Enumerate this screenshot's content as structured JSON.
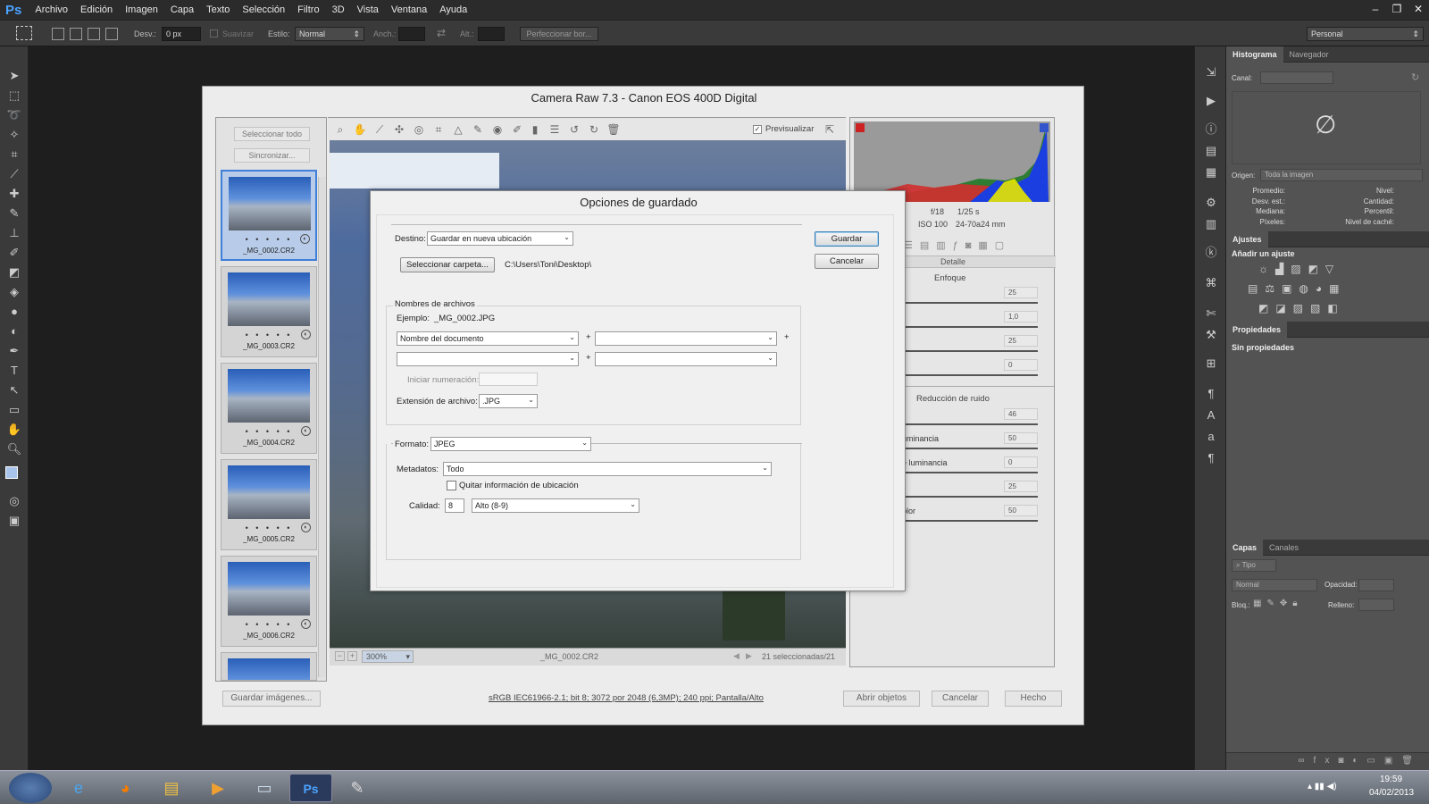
{
  "app": {
    "logo": "Ps"
  },
  "menu": [
    "Archivo",
    "Edición",
    "Imagen",
    "Capa",
    "Texto",
    "Selección",
    "Filtro",
    "3D",
    "Vista",
    "Ventana",
    "Ayuda"
  ],
  "window_buttons": [
    "–",
    "❐",
    "✕"
  ],
  "options_bar": {
    "desv_label": "Desv.:",
    "desv_value": "0 px",
    "suavizar_label": "Suavizar",
    "estilo_label": "Estilo:",
    "estilo_value": "Normal",
    "anch_label": "Anch.:",
    "alt_label": "Alt.:",
    "refine_button": "Perfeccionar bor...",
    "workspace": "Personal"
  },
  "histogram_panel": {
    "tabs": [
      "Histograma",
      "Navegador"
    ],
    "canal_label": "Canal:",
    "origen_label": "Origen:",
    "origen_value": "Toda la imagen",
    "stats_left": [
      "Promedio:",
      "Desv. est.:",
      "Mediana:",
      "Píxeles:"
    ],
    "stats_right": [
      "Nivel:",
      "Cantidad:",
      "Percentil:",
      "Nivel de caché:"
    ]
  },
  "adjustments_panel": {
    "tab": "Ajustes",
    "subtitle": "Añadir un ajuste"
  },
  "properties_panel": {
    "tab": "Propiedades",
    "empty": "Sin propiedades"
  },
  "layers_panel": {
    "tabs": [
      "Capas",
      "Canales"
    ],
    "filter": "Tipo",
    "blend": "Normal",
    "opacity_label": "Opacidad:",
    "lock_label": "Bloq.:",
    "fill_label": "Relleno:"
  },
  "camera_raw": {
    "title": "Camera Raw 7.3 -  Canon EOS 400D Digital",
    "select_all": "Seleccionar todo",
    "sync": "Sincronizar...",
    "thumbnails": [
      {
        "caption": "_MG_0002.CR2",
        "dots": "• • • • •"
      },
      {
        "caption": "_MG_0003.CR2",
        "dots": "• • • • •"
      },
      {
        "caption": "_MG_0004.CR2",
        "dots": "• • • • •"
      },
      {
        "caption": "_MG_0005.CR2",
        "dots": "• • • • •"
      },
      {
        "caption": "_MG_0006.CR2",
        "dots": "• • • • •"
      }
    ],
    "preview_label": "Previsualizar",
    "zoom": "300%",
    "filename": "_MG_0002.CR2",
    "selected_count": "21 seleccionadas/21",
    "exif_aperture": "f/18",
    "exif_shutter": "1/25 s",
    "exif_iso": "ISO 100",
    "exif_lens": "24-70a24 mm",
    "detail_tab": "Detalle",
    "sharpening_title": "Enfoque",
    "sharpen_values": [
      "25",
      "1,0",
      "25",
      "0"
    ],
    "noise_title": "Reducción de ruido",
    "noise_rows": [
      {
        "label": "",
        "value": "46"
      },
      {
        "label": "uminancia",
        "value": "50"
      },
      {
        "label": "e luminancia",
        "value": "0"
      },
      {
        "label": "",
        "value": "25"
      },
      {
        "label": "olor",
        "value": "50"
      }
    ],
    "save_images": "Guardar imágenes...",
    "workflow_link": "sRGB IEC61966-2.1; bit 8; 3072 por 2048 (6,3MP); 240 ppi; Pantalla/Alto",
    "open_objects": "Abrir objetos",
    "cancel": "Cancelar",
    "done": "Hecho"
  },
  "save_dialog": {
    "title": "Opciones de guardado",
    "destino_label": "Destino:",
    "destino_value": "Guardar en nueva ubicación",
    "select_folder": "Seleccionar carpeta...",
    "folder_path": "C:\\Users\\Toni\\Desktop\\",
    "save_button": "Guardar",
    "cancel_button": "Cancelar",
    "filenames_group": "Nombres de archivos",
    "example_label": "Ejemplo:",
    "example_value": "_MG_0002.JPG",
    "name_part1": "Nombre del documento",
    "plus": "+",
    "start_numbering_label": "Iniciar numeración:",
    "extension_label": "Extensión de archivo:",
    "extension_value": ".JPG",
    "format_label": "Formato:",
    "format_value": "JPEG",
    "metadata_label": "Metadatos:",
    "metadata_value": "Todo",
    "remove_location": "Quitar información de ubicación",
    "quality_label": "Calidad:",
    "quality_value": "8",
    "quality_preset": "Alto  (8-9)"
  },
  "taskbar": {
    "apps": [
      "ie-icon",
      "firefox-icon",
      "explorer-icon",
      "media-icon",
      "network-icon",
      "photoshop-icon",
      "paint-icon"
    ],
    "time": "19:59",
    "date": "04/02/2013"
  }
}
